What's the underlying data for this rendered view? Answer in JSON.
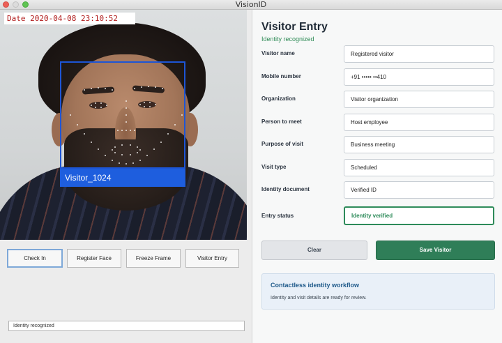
{
  "window": {
    "title": "VisionID"
  },
  "camera": {
    "date_stamp": "Date 2020-04-08 23:10:52",
    "face_label": "Visitor_1024"
  },
  "actions": {
    "check_in": "Check In",
    "register_face": "Register Face",
    "freeze_frame": "Freeze Frame",
    "visitor_entry": "Visitor Entry"
  },
  "status_bar": {
    "text": "Identity recognized"
  },
  "form": {
    "title": "Visitor Entry",
    "subtitle": "Identity recognized",
    "fields": [
      {
        "label": "Visitor name",
        "value": "Registered visitor"
      },
      {
        "label": "Mobile number",
        "value": "+91 ••••• ••410"
      },
      {
        "label": "Organization",
        "value": "Visitor organization"
      },
      {
        "label": "Person to meet",
        "value": "Host employee"
      },
      {
        "label": "Purpose of visit",
        "value": "Business meeting"
      },
      {
        "label": "Visit type",
        "value": "Scheduled"
      },
      {
        "label": "Identity document",
        "value": "Verified ID"
      },
      {
        "label": "Entry status",
        "value": "Identity verified"
      }
    ],
    "clear_label": "Clear",
    "save_label": "Save Visitor"
  },
  "info_card": {
    "title": "Contactless identity workflow",
    "body": "Identity and visit details are ready for review."
  },
  "colors": {
    "accent_green": "#2f7e58",
    "face_box_blue": "#1e5ede",
    "date_red": "#b01818",
    "info_title_blue": "#1f5a8a"
  }
}
